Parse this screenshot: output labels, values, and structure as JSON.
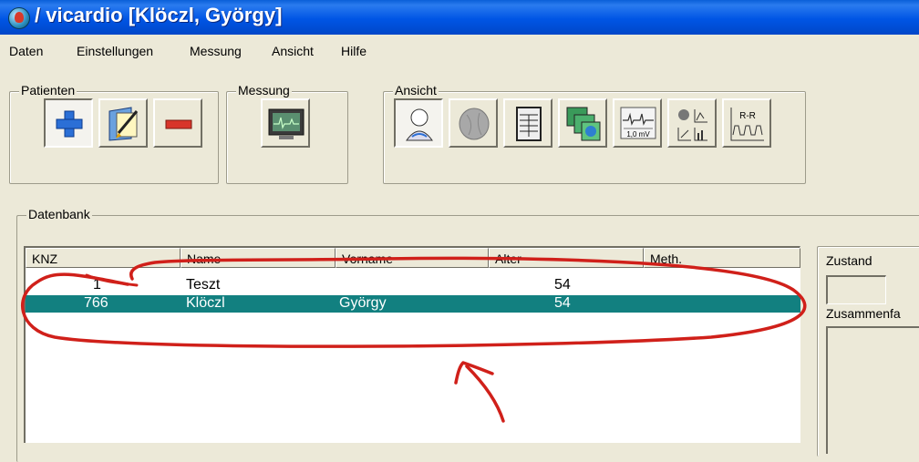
{
  "window": {
    "title": "/ vicardio [Klöczl, György]"
  },
  "menu": [
    "Daten",
    "Einstellungen",
    "Messung",
    "Ansicht",
    "Hilfe"
  ],
  "toolbar": {
    "patienten_label": "Patienten",
    "messung_label": "Messung",
    "ansicht_label": "Ansicht",
    "ecg_scale_label": "1,0 mV",
    "rr_label": "R-R"
  },
  "datenbank": {
    "label": "Datenbank",
    "columns": [
      "KNZ",
      "Name",
      "Vorname",
      "Alter",
      "Meth."
    ],
    "rows": [
      {
        "knz": "1",
        "name": "Teszt",
        "vorname": "",
        "alter": "54",
        "meth": ""
      },
      {
        "knz": "766",
        "name": "Klöczl",
        "vorname": "György",
        "alter": "54",
        "meth": ""
      }
    ],
    "selected_row": 1
  },
  "side_panel": {
    "zustand_label": "Zustand",
    "zusammen_label": "Zusammenfa"
  },
  "colors": {
    "selection": "#128080",
    "annotation": "#d0201a",
    "titlebar": "#0055e5"
  }
}
